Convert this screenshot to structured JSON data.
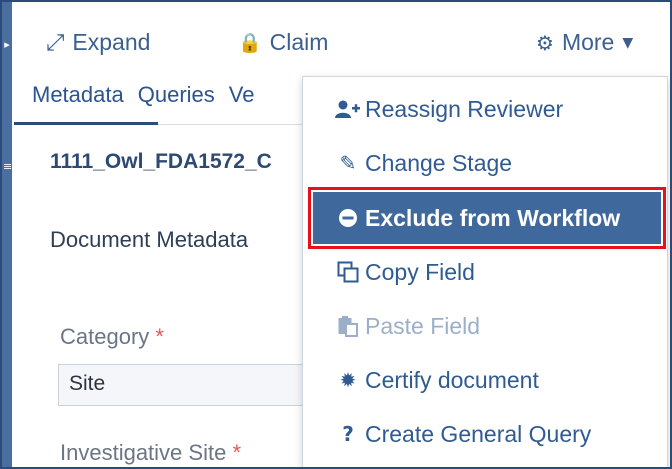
{
  "toolbar": {
    "expand_icon": "expand-arrows-icon",
    "expand_label": "Expand",
    "claim_icon": "lock-icon",
    "claim_label": "Claim",
    "more_icon": "gear-icon",
    "more_label": "More",
    "more_caret": "caret-down-icon"
  },
  "tabs": [
    {
      "label": "Metadata",
      "active": true
    },
    {
      "label": "Queries",
      "active": false
    },
    {
      "label": "Ve",
      "active": false
    }
  ],
  "document": {
    "title": "1111_Owl_FDA1572_C",
    "section_title": "Document Metadata"
  },
  "fields": {
    "category_label": "Category",
    "category_required": "*",
    "category_value": "Site",
    "investigative_site_label": "Investigative Site",
    "investigative_site_required": "*"
  },
  "menu": {
    "items": [
      {
        "label": "Reassign Reviewer",
        "icon": "user-plus-icon",
        "glyph": "👥",
        "state": "normal"
      },
      {
        "label": "Change Stage",
        "icon": "pencil-icon",
        "glyph": "✎",
        "state": "normal"
      },
      {
        "label": "Exclude from Workflow",
        "icon": "minus-circle-icon",
        "glyph": "⊖",
        "state": "highlighted"
      },
      {
        "label": "Copy Field",
        "icon": "copy-icon",
        "glyph": "⧉",
        "state": "normal"
      },
      {
        "label": "Paste Field",
        "icon": "paste-icon",
        "glyph": "📋",
        "state": "disabled"
      },
      {
        "label": "Certify document",
        "icon": "certificate-icon",
        "glyph": "✹",
        "state": "normal"
      },
      {
        "label": "Create General Query",
        "icon": "question-icon",
        "glyph": "?",
        "state": "normal"
      }
    ]
  },
  "colors": {
    "link_blue": "#2f5b92",
    "highlight_bg": "#3f689c",
    "annotation_red": "#e8101c",
    "required_red": "#e05a5a"
  }
}
